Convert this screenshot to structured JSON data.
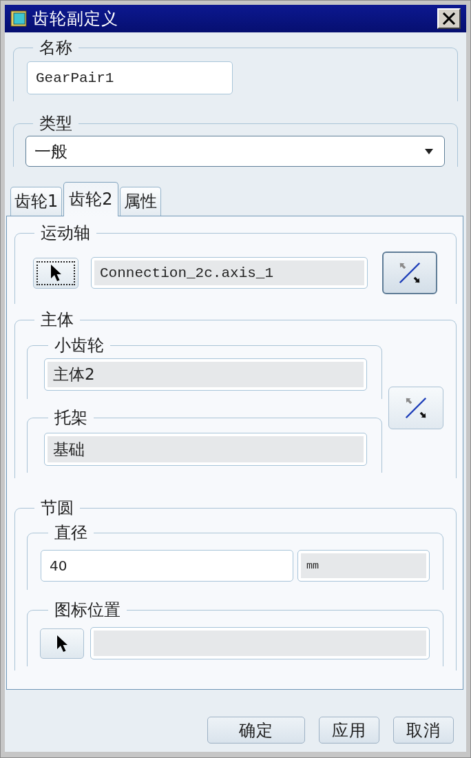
{
  "window": {
    "title": "齿轮副定义"
  },
  "name": {
    "label": "名称",
    "value": "GearPair1"
  },
  "type": {
    "label": "类型",
    "value": "一般"
  },
  "tabs": [
    {
      "label": "齿轮1",
      "selected": false
    },
    {
      "label": "齿轮2",
      "selected": true
    },
    {
      "label": "属性",
      "selected": false
    }
  ],
  "motion_axis": {
    "label": "运动轴",
    "selector_focused": true,
    "value": "Connection_2c.axis_1",
    "flip_active": true
  },
  "bodies": {
    "label": "主体",
    "pinion": {
      "label": "小齿轮",
      "value": "主体2"
    },
    "carrier": {
      "label": "托架",
      "value": "基础"
    },
    "flip_active": false
  },
  "pitch_circle": {
    "label": "节圆",
    "diameter": {
      "label": "直径",
      "value": "40",
      "unit": "mm"
    },
    "icon_location": {
      "label": "图标位置",
      "selector_focused": false
    }
  },
  "buttons": [
    {
      "label": "确定"
    },
    {
      "label": "应用"
    },
    {
      "label": "取消"
    }
  ]
}
